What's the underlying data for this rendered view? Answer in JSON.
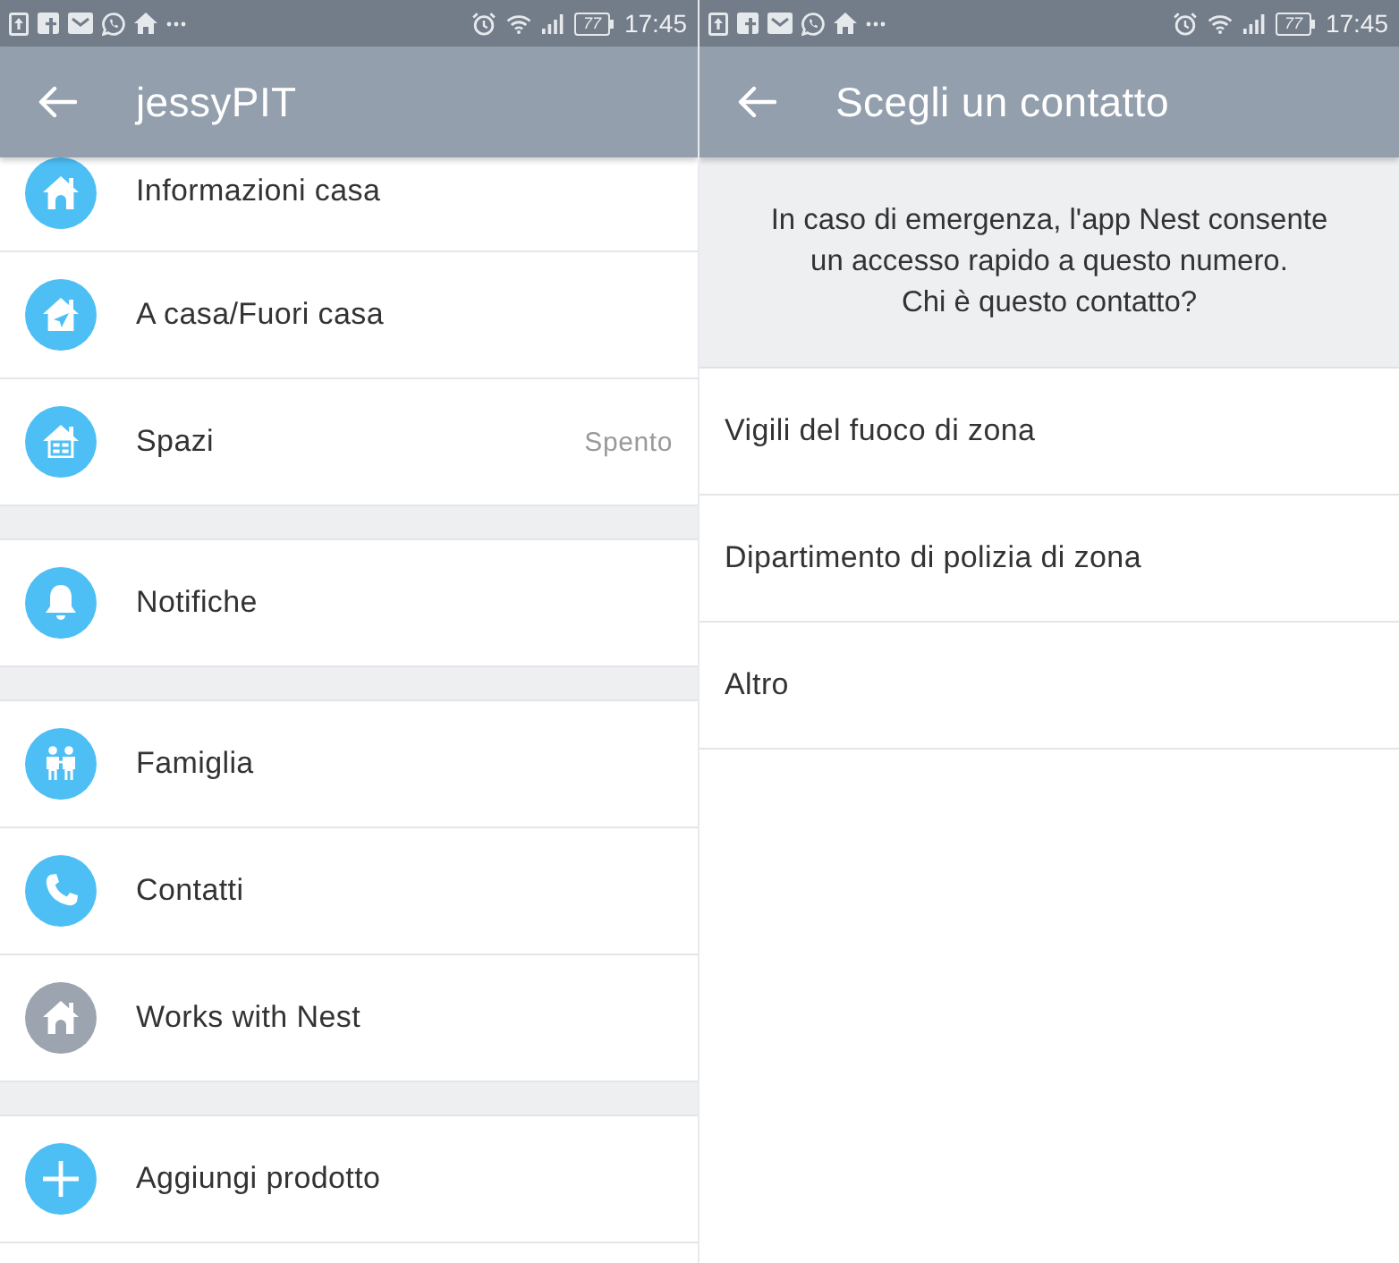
{
  "screens": [
    {
      "kind": "settings",
      "status_bar": {
        "battery": "77",
        "time": "17:45"
      },
      "app_bar": {
        "title": "jessyPIT"
      },
      "sections": [
        {
          "items": [
            {
              "label": "Informazioni casa",
              "color": "#4dbff5"
            },
            {
              "label": "A casa/Fuori casa",
              "color": "#4dbff5"
            },
            {
              "label": "Spazi",
              "value": "Spento",
              "color": "#4dbff5"
            }
          ]
        },
        {
          "items": [
            {
              "label": "Notifiche",
              "color": "#4dbff5"
            }
          ]
        },
        {
          "items": [
            {
              "label": "Famiglia",
              "color": "#4dbff5"
            },
            {
              "label": "Contatti",
              "color": "#4dbff5"
            },
            {
              "label": "Works with Nest",
              "color": "#9ba4af"
            }
          ]
        },
        {
          "items": [
            {
              "label": "Aggiungi prodotto",
              "color": "#4dbff5"
            }
          ]
        }
      ]
    },
    {
      "kind": "picker",
      "status_bar": {
        "battery": "77",
        "time": "17:45"
      },
      "app_bar": {
        "title": "Scegli un contatto"
      },
      "intro": "In caso di emergenza, l'app Nest consente\nun accesso rapido a questo numero.\nChi è questo contatto?",
      "options": [
        {
          "label": "Vigili del fuoco di zona"
        },
        {
          "label": "Dipartimento di polizia di zona"
        },
        {
          "label": "Altro"
        }
      ]
    }
  ]
}
